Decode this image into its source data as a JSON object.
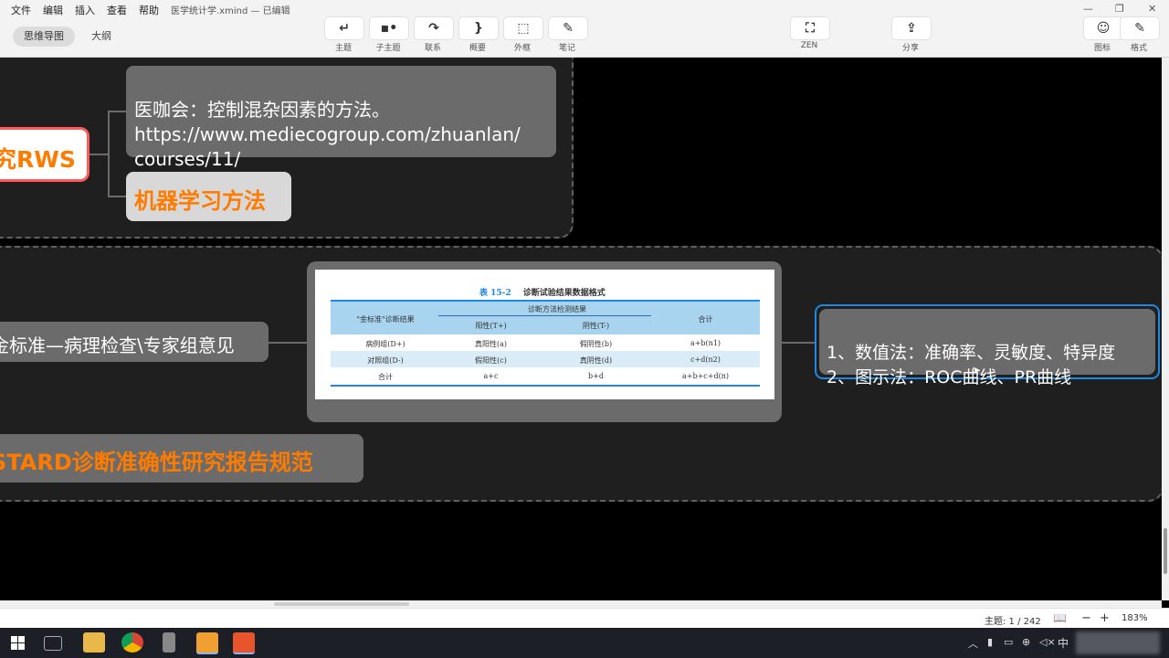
{
  "menu": [
    "文件",
    "编辑",
    "插入",
    "查看",
    "帮助"
  ],
  "doc_title": "医学统计学.xmind — 已编辑",
  "view_tabs": [
    "思维导图",
    "大纲"
  ],
  "toolbar": [
    {
      "icon": "topic-icon",
      "glyph": "↵",
      "label": "主题"
    },
    {
      "icon": "subtopic-icon",
      "glyph": "▪•",
      "label": "子主题"
    },
    {
      "icon": "relationship-icon",
      "glyph": "↷",
      "label": "联系"
    },
    {
      "icon": "summary-icon",
      "glyph": "}",
      "label": "概要"
    },
    {
      "icon": "boundary-icon",
      "glyph": "⬚",
      "label": "外框"
    },
    {
      "icon": "note-icon",
      "glyph": "✎",
      "label": "笔记"
    }
  ],
  "zen": {
    "glyph": "⛶",
    "label": "ZEN"
  },
  "share": {
    "glyph": "⇪",
    "label": "分享"
  },
  "right_tools": [
    {
      "glyph": "☺",
      "label": "图标"
    },
    {
      "glyph": "✎",
      "label": "格式"
    }
  ],
  "window_controls": [
    "—",
    "❐",
    "✕"
  ],
  "mindmap": {
    "rws_node": "究RWS",
    "note_node": "医咖会：控制混杂因素的方法。\nhttps://www.mediecogroup.com/zhuanlan/\ncourses/11/",
    "ml_node": "机器学习方法",
    "gold_node": "金标准—病理检查\\专家组意见",
    "stard_node": "STARD诊断准确性研究报告规范",
    "methods_node": "1、数值法：准确率、灵敏度、特异度\n2、图示法：ROC曲线、PR曲线"
  },
  "table_image": {
    "caption_num": "表 15-2",
    "caption": "诊断试验结果数据格式",
    "header_gold": "\"金标准\"诊断结果",
    "header_method": "诊断方法检测结果",
    "header_pos": "阳性(T+)",
    "header_neg": "阴性(T-)",
    "header_total": "合计",
    "rows": [
      [
        "病例组(D+)",
        "真阳性(a)",
        "假阴性(b)",
        "a+b(n1)"
      ],
      [
        "对照组(D-)",
        "假阳性(c)",
        "真阴性(d)",
        "c+d(n2)"
      ],
      [
        "合计",
        "a+c",
        "b+d",
        "a+b+c+d(n)"
      ]
    ]
  },
  "status": {
    "topic_count": "主题: 1 / 242",
    "zoom_minus": "−",
    "zoom_plus": "+",
    "zoom": "183%"
  },
  "tray": {
    "ime": "中"
  },
  "colors": {
    "orange": "#ff7b00",
    "node_gray": "#6b6b6b",
    "selection_blue": "#1e88e5",
    "table_blue": "#a8d4f0"
  }
}
